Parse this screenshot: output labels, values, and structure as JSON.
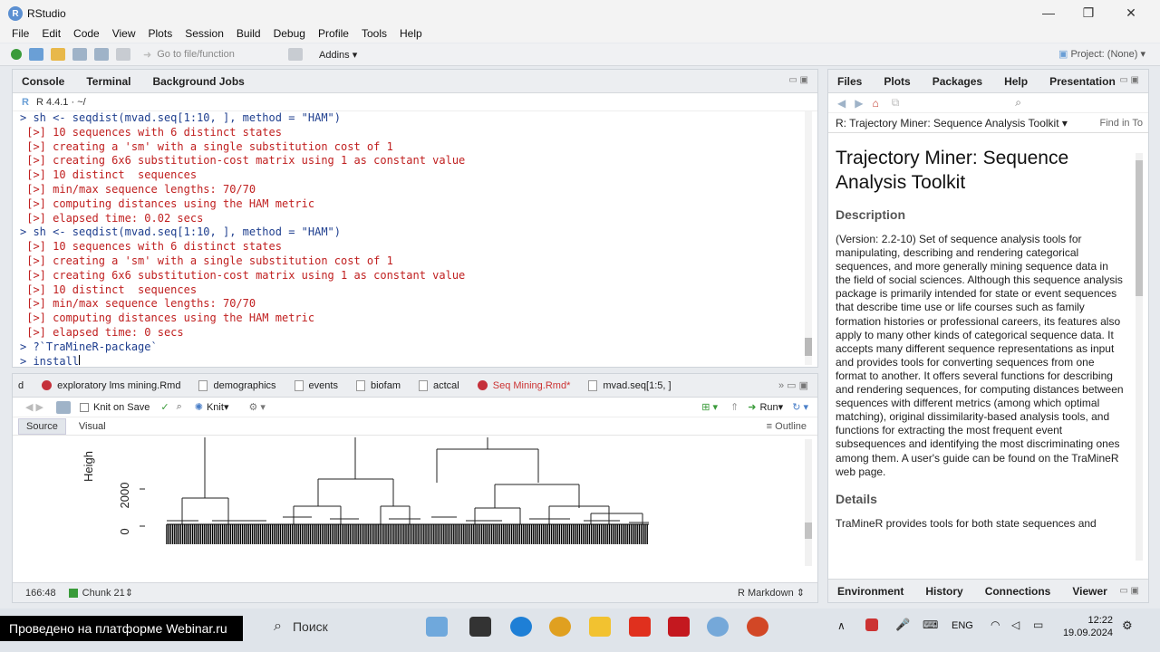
{
  "window": {
    "title": "RStudio"
  },
  "menu": [
    "File",
    "Edit",
    "Code",
    "View",
    "Plots",
    "Session",
    "Build",
    "Debug",
    "Profile",
    "Tools",
    "Help"
  ],
  "toolbar": {
    "goto_placeholder": "Go to file/function",
    "addins_label": "Addins",
    "project_label": "Project: (None)"
  },
  "console": {
    "tabs": [
      "Console",
      "Terminal",
      "Background Jobs"
    ],
    "r_version": "R 4.4.1 · ~/",
    "lines": [
      {
        "type": "cmd",
        "text": "> sh <- seqdist(mvad.seq[1:10, ], method = \"HAM\")"
      },
      {
        "type": "out",
        "text": " [>] 10 sequences with 6 distinct states"
      },
      {
        "type": "out",
        "text": " [>] creating a 'sm' with a single substitution cost of 1"
      },
      {
        "type": "out",
        "text": " [>] creating 6x6 substitution-cost matrix using 1 as constant value"
      },
      {
        "type": "out",
        "text": " [>] 10 distinct  sequences"
      },
      {
        "type": "out",
        "text": " [>] min/max sequence lengths: 70/70"
      },
      {
        "type": "out",
        "text": " [>] computing distances using the HAM metric"
      },
      {
        "type": "out",
        "text": " [>] elapsed time: 0.02 secs"
      },
      {
        "type": "cmd",
        "text": "> sh <- seqdist(mvad.seq[1:10, ], method = \"HAM\")"
      },
      {
        "type": "out",
        "text": " [>] 10 sequences with 6 distinct states"
      },
      {
        "type": "out",
        "text": " [>] creating a 'sm' with a single substitution cost of 1"
      },
      {
        "type": "out",
        "text": " [>] creating 6x6 substitution-cost matrix using 1 as constant value"
      },
      {
        "type": "out",
        "text": " [>] 10 distinct  sequences"
      },
      {
        "type": "out",
        "text": " [>] min/max sequence lengths: 70/70"
      },
      {
        "type": "out",
        "text": " [>] computing distances using the HAM metric"
      },
      {
        "type": "out",
        "text": " [>] elapsed time: 0 secs"
      },
      {
        "type": "cmd",
        "text": "> ?`TraMineR-package`"
      },
      {
        "type": "cmd",
        "text": "> install"
      }
    ]
  },
  "editor": {
    "tabs": [
      "d",
      "exploratory lms mining.Rmd",
      "demographics",
      "events",
      "biofam",
      "actcal",
      "Seq Mining.Rmd*",
      "mvad.seq[1:5, ]"
    ],
    "active_tab": "Seq Mining.Rmd*",
    "knit_on_save": "Knit on Save",
    "knit_label": "Knit",
    "run_label": "Run",
    "outline_label": "Outline",
    "modes": [
      "Source",
      "Visual"
    ],
    "plot_ylabel": "Heigh",
    "plot_ticks": [
      "2000",
      "0"
    ],
    "status_position": "166:48",
    "status_chunk": "Chunk 21",
    "status_type": "R Markdown"
  },
  "help": {
    "tabs": [
      "Files",
      "Plots",
      "Packages",
      "Help",
      "Presentation"
    ],
    "topic": "R: Trajectory Miner: Sequence Analysis Toolkit",
    "find_label": "Find in To",
    "title": "Trajectory Miner: Sequence Analysis Toolkit",
    "desc_heading": "Description",
    "desc_text": "(Version: 2.2-10) Set of sequence analysis tools for manipulating, describing and rendering categorical sequences, and more generally mining sequence data in the field of social sciences. Although this sequence analysis package is primarily intended for state or event sequences that describe time use or life courses such as family formation histories or professional careers, its features also apply to many other kinds of categorical sequence data. It accepts many different sequence representations as input and provides tools for converting sequences from one format to another. It offers several functions for describing and rendering sequences, for computing distances between sequences with different metrics (among which optimal matching), original dissimilarity-based analysis tools, and functions for extracting the most frequent event subsequences and identifying the most discriminating ones among them. A user's guide can be found on the TraMineR web page.",
    "details_heading": "Details",
    "details_text": "TraMineR provides tools for both state sequences and",
    "env_tabs": [
      "Environment",
      "History",
      "Connections",
      "Viewer"
    ]
  },
  "taskbar": {
    "webinar_banner": "Проведено на платформе Webinar.ru",
    "search_placeholder": "Поиск",
    "lang": "ENG",
    "time": "12:22",
    "date": "19.09.2024"
  }
}
